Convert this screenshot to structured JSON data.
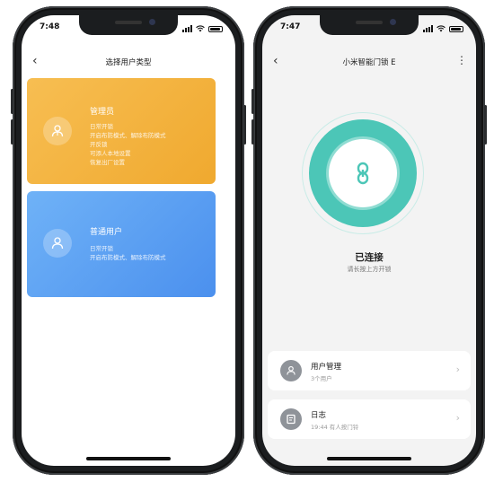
{
  "left": {
    "time": "7:48",
    "title": "选择用户类型",
    "admin": {
      "title": "管理员",
      "lines": [
        "日常开锁",
        "开启布防模式、解除布防模式",
        "开反锁",
        "可添人本地设置",
        "恢复出厂设置"
      ],
      "gradient_from": "#f7be52",
      "gradient_to": "#f0a92f"
    },
    "normal": {
      "title": "普通用户",
      "lines": [
        "日常开锁",
        "开启布防模式、解除布防模式"
      ],
      "gradient_from": "#6fb2f7",
      "gradient_to": "#4b90ee"
    }
  },
  "right": {
    "time": "7:47",
    "title": "小米智能门锁 E",
    "status": "已连接",
    "hint": "请长按上方开锁",
    "accent": "#4cc6b7",
    "menu": [
      {
        "title": "用户管理",
        "sub": "3个用户",
        "icon": "user-icon"
      },
      {
        "title": "日志",
        "sub": "19:44 有人按门铃",
        "icon": "log-icon"
      }
    ]
  }
}
